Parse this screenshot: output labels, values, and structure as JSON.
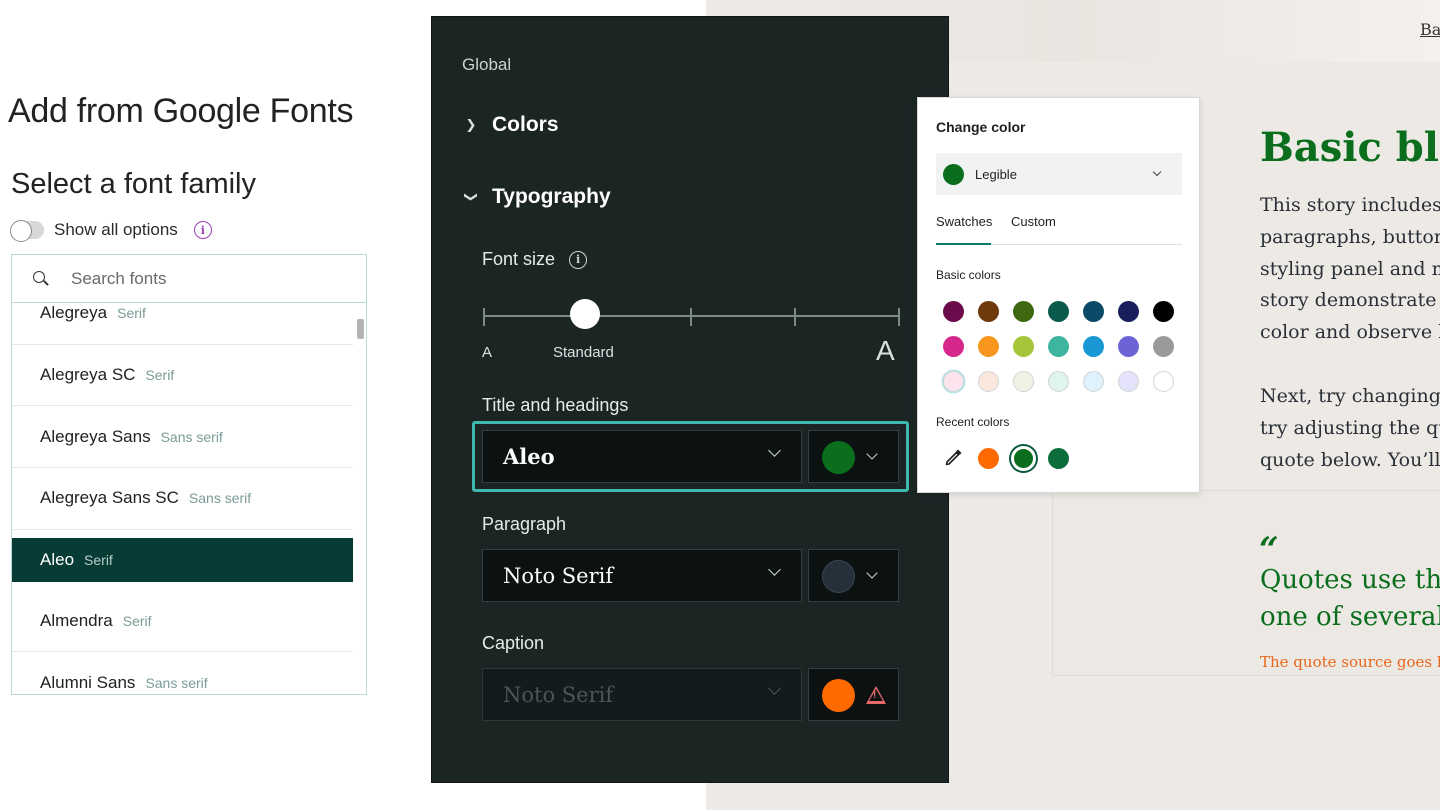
{
  "google_fonts": {
    "title": "Add from Google Fonts",
    "subtitle": "Select a font family",
    "toggle_label": "Show all options",
    "search_placeholder": "Search fonts",
    "fonts": [
      {
        "name": "Alegreya",
        "category": "Serif",
        "selected": false
      },
      {
        "name": "Alegreya SC",
        "category": "Serif",
        "selected": false
      },
      {
        "name": "Alegreya Sans",
        "category": "Sans serif",
        "selected": false
      },
      {
        "name": "Alegreya Sans SC",
        "category": "Sans serif",
        "selected": false
      },
      {
        "name": "Aleo",
        "category": "Serif",
        "selected": true
      },
      {
        "name": "Almendra",
        "category": "Serif",
        "selected": false
      },
      {
        "name": "Alumni Sans",
        "category": "Sans serif",
        "selected": false
      }
    ]
  },
  "panel": {
    "section_label": "Global",
    "colors_label": "Colors",
    "typography_label": "Typography",
    "font_size_label": "Font size",
    "slider": {
      "min_label": "A",
      "current_label": "Standard",
      "max_label": "A",
      "stops": 5,
      "current_index": 1
    },
    "title_headings": {
      "label": "Title and headings",
      "font": "Aleo",
      "color": "#0a6e1d"
    },
    "paragraph": {
      "label": "Paragraph",
      "font": "Noto Serif",
      "color": "#25303a"
    },
    "caption": {
      "label": "Caption",
      "font": "Noto Serif",
      "color": "#ff6a00",
      "warning": true
    }
  },
  "color_popup": {
    "title": "Change color",
    "selected_name": "Legible",
    "selected_color": "#0a6e1d",
    "tabs": [
      "Swatches",
      "Custom"
    ],
    "active_tab": "Swatches",
    "basic_colors_label": "Basic colors",
    "basic_colors": [
      [
        "#6b0b4c",
        "#6e3a0b",
        "#3e6710",
        "#0b5a4e",
        "#0b4b68",
        "#191e5c",
        "#000000"
      ],
      [
        "#d6288c",
        "#f8961d",
        "#a6c53a",
        "#3db59f",
        "#1998d4",
        "#6c64d6",
        "#9a9a9a"
      ],
      [
        "#fde3ee",
        "#fbe7de",
        "#f0f3e4",
        "#e0f4ee",
        "#dff2fb",
        "#e5e2fb",
        "#ffffff"
      ]
    ],
    "recent_colors_label": "Recent colors",
    "recent_colors": [
      "#ff6a00",
      "#0a6e1d",
      "#0b6e3a"
    ],
    "eyedropper_icon": "eyedropper-icon"
  },
  "story": {
    "nav_link": "Ba",
    "heading": "Basic bloc",
    "paragraph1": [
      "This story includes s",
      "paragraphs, buttons",
      "styling panel and m",
      "story demonstrate h",
      "color and observe h"
    ],
    "paragraph2": [
      "Next, try changing t",
      "try adjusting the qu",
      "quote below. You’ll a"
    ],
    "quote_mark": "“",
    "quote_lines": [
      "Quotes use the",
      "one of several"
    ],
    "quote_source": "The quote source goes h"
  }
}
